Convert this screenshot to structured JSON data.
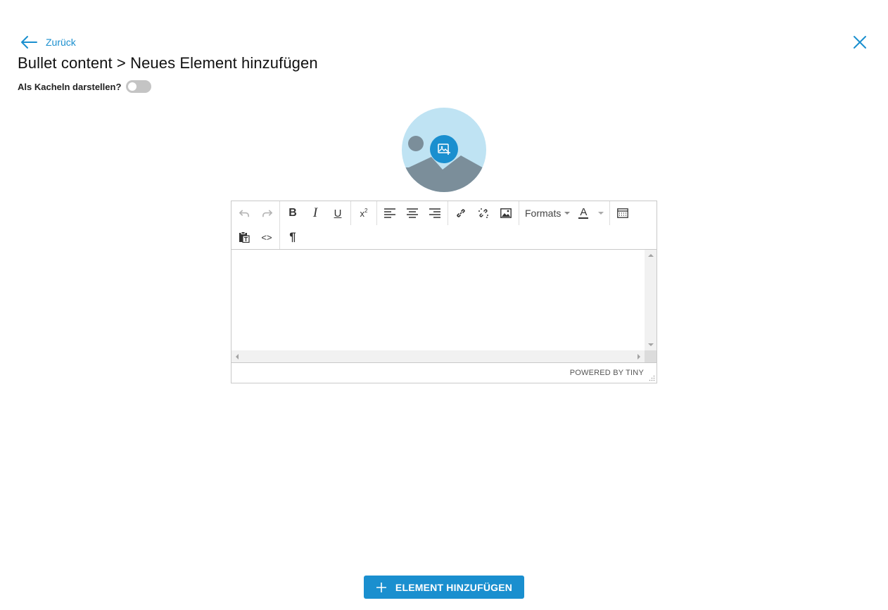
{
  "header": {
    "back_label": "Zurück",
    "title": "Bullet content > Neues Element hinzufügen"
  },
  "settings": {
    "tile_toggle_label": "Als Kacheln darstellen?",
    "tile_toggle_on": false
  },
  "image_upload": {
    "icon": "image-add-icon"
  },
  "editor": {
    "toolbar_row1": [
      "undo-icon",
      "redo-icon",
      "bold-icon",
      "italic-icon",
      "underline-icon",
      "superscript-icon",
      "align-left-icon",
      "align-center-icon",
      "align-right-icon",
      "link-icon",
      "unlink-icon",
      "image-icon",
      "formats-dropdown",
      "text-color-picker",
      "table-icon"
    ],
    "toolbar_row2": [
      "paste-text-icon",
      "code-icon",
      "paragraph-icon"
    ],
    "labels": {
      "bold": "B",
      "italic": "I",
      "underline": "U",
      "superscript_base": "x",
      "superscript_exp": "2",
      "code": "<>",
      "paragraph": "¶",
      "text_color": "A"
    },
    "formats_label": "Formats",
    "content": "",
    "powered_by": "POWERED BY TINY"
  },
  "actions": {
    "add_element_label": "ELEMENT HINZUFÜGEN"
  },
  "colors": {
    "accent": "#1a8fcf",
    "placeholder_bg": "#bfe3f3",
    "placeholder_shape": "#7b8e9a",
    "toggle_off": "#c4c4c4"
  }
}
